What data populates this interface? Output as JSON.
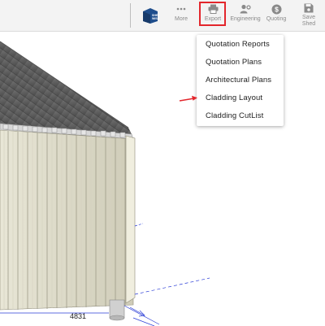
{
  "toolbar": {
    "brand_label": "SHED WISE",
    "buttons": [
      {
        "label": "More",
        "icon": "more-icon"
      },
      {
        "label": "Export",
        "icon": "printer-icon"
      },
      {
        "label": "Engineering",
        "icon": "engineering-icon"
      },
      {
        "label": "Quoting",
        "icon": "dollar-icon"
      },
      {
        "label": "Save Shed",
        "icon": "save-icon"
      }
    ],
    "highlight_color": "#e3262c"
  },
  "export_menu": {
    "items": [
      "Quotation Reports",
      "Quotation Plans",
      "Architectural Plans",
      "Cladding Layout",
      "Cladding CutList"
    ]
  },
  "scene": {
    "dimension_label": "4831",
    "arrow_color": "#e3262c",
    "dimension_line_color": "#2a3cd6"
  }
}
